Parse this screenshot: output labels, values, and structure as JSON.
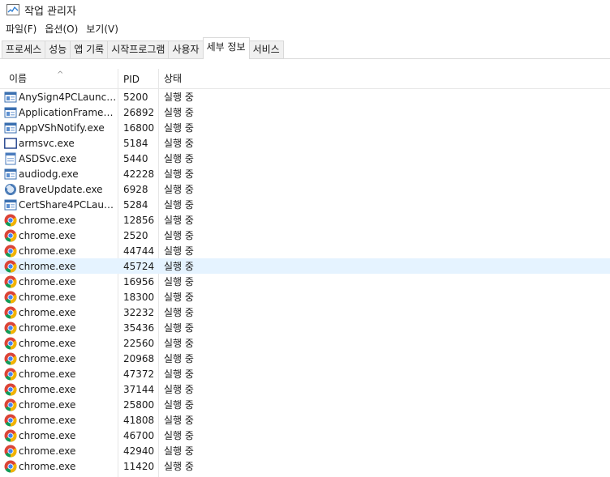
{
  "window": {
    "title": "작업 관리자"
  },
  "menu": [
    "파일(F)",
    "옵션(O)",
    "보기(V)"
  ],
  "tabs": [
    {
      "label": "프로세스",
      "active": false
    },
    {
      "label": "성능",
      "active": false
    },
    {
      "label": "앱 기록",
      "active": false
    },
    {
      "label": "시작프로그램",
      "active": false
    },
    {
      "label": "사용자",
      "active": false
    },
    {
      "label": "세부 정보",
      "active": true
    },
    {
      "label": "서비스",
      "active": false
    }
  ],
  "columns": {
    "name": "이름",
    "pid": "PID",
    "status": "상태"
  },
  "rows": [
    {
      "icon": "window-app-icon",
      "name": "AnySign4PCLaunch...",
      "pid": "5200",
      "status": "실행 중"
    },
    {
      "icon": "window-app-icon",
      "name": "ApplicationFrameHo...",
      "pid": "26892",
      "status": "실행 중"
    },
    {
      "icon": "window-app-icon",
      "name": "AppVShNotify.exe",
      "pid": "16800",
      "status": "실행 중"
    },
    {
      "icon": "blank-window-icon",
      "name": "armsvc.exe",
      "pid": "5184",
      "status": "실행 중"
    },
    {
      "icon": "service-icon",
      "name": "ASDSvc.exe",
      "pid": "5440",
      "status": "실행 중"
    },
    {
      "icon": "window-app-icon",
      "name": "audiodg.exe",
      "pid": "42228",
      "status": "실행 중"
    },
    {
      "icon": "brave-update-icon",
      "name": "BraveUpdate.exe",
      "pid": "6928",
      "status": "실행 중"
    },
    {
      "icon": "window-app-icon",
      "name": "CertShare4PCLaunc...",
      "pid": "5284",
      "status": "실행 중"
    },
    {
      "icon": "chrome-icon",
      "name": "chrome.exe",
      "pid": "12856",
      "status": "실행 중"
    },
    {
      "icon": "chrome-icon",
      "name": "chrome.exe",
      "pid": "2520",
      "status": "실행 중"
    },
    {
      "icon": "chrome-icon",
      "name": "chrome.exe",
      "pid": "44744",
      "status": "실행 중"
    },
    {
      "icon": "chrome-icon",
      "name": "chrome.exe",
      "pid": "45724",
      "status": "실행 중",
      "selected": true
    },
    {
      "icon": "chrome-icon",
      "name": "chrome.exe",
      "pid": "16956",
      "status": "실행 중"
    },
    {
      "icon": "chrome-icon",
      "name": "chrome.exe",
      "pid": "18300",
      "status": "실행 중"
    },
    {
      "icon": "chrome-icon",
      "name": "chrome.exe",
      "pid": "32232",
      "status": "실행 중"
    },
    {
      "icon": "chrome-icon",
      "name": "chrome.exe",
      "pid": "35436",
      "status": "실행 중"
    },
    {
      "icon": "chrome-icon",
      "name": "chrome.exe",
      "pid": "22560",
      "status": "실행 중"
    },
    {
      "icon": "chrome-icon",
      "name": "chrome.exe",
      "pid": "20968",
      "status": "실행 중"
    },
    {
      "icon": "chrome-icon",
      "name": "chrome.exe",
      "pid": "47372",
      "status": "실행 중"
    },
    {
      "icon": "chrome-icon",
      "name": "chrome.exe",
      "pid": "37144",
      "status": "실행 중"
    },
    {
      "icon": "chrome-icon",
      "name": "chrome.exe",
      "pid": "25800",
      "status": "실행 중"
    },
    {
      "icon": "chrome-icon",
      "name": "chrome.exe",
      "pid": "41808",
      "status": "실행 중"
    },
    {
      "icon": "chrome-icon",
      "name": "chrome.exe",
      "pid": "46700",
      "status": "실행 중"
    },
    {
      "icon": "chrome-icon",
      "name": "chrome.exe",
      "pid": "42940",
      "status": "실행 중"
    },
    {
      "icon": "chrome-icon",
      "name": "chrome.exe",
      "pid": "11420",
      "status": "실행 중"
    }
  ],
  "colors": {
    "selected_row": "#e5f3ff",
    "border": "#d9d9d9"
  }
}
